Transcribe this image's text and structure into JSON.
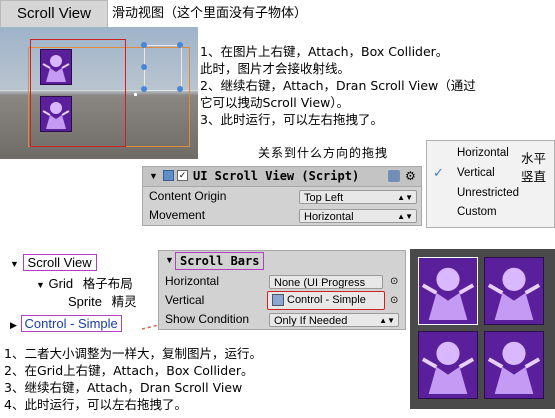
{
  "title_tab": "Scroll View",
  "title_note": "滑动视图（这个里面没有子物体）",
  "notes_top": [
    "1、在图片上右键，Attach，Box Collider。",
    "此时，图片才会接收射线。",
    "2、继续右键，Attach，Dran Scroll View（通过",
    "它可以拽动Scroll View）。",
    "3、此时运行，可以左右拖拽了。"
  ],
  "relation_note": "关系到什么方向的拖拽",
  "inspector": {
    "title": "UI Scroll View (Script)",
    "rows": [
      {
        "label": "Content Origin",
        "value": "Top Left"
      },
      {
        "label": "Movement",
        "value": "Horizontal"
      }
    ]
  },
  "movement_menu": {
    "items": [
      "Horizontal",
      "Vertical",
      "Unrestricted",
      "Custom"
    ],
    "selected": "Vertical",
    "check_mark": "✓"
  },
  "menu_notes": {
    "horizontal": "水平",
    "vertical": "竖直"
  },
  "hierarchy": {
    "items": [
      {
        "label": "Scroll View",
        "note": ""
      },
      {
        "label": "Grid",
        "note": "格子布局"
      },
      {
        "label": "Sprite",
        "note": "精灵"
      },
      {
        "label": "Control - Simple",
        "note": ""
      }
    ]
  },
  "scroll_bars": {
    "header": "Scroll Bars",
    "rows": [
      {
        "label": "Horizontal",
        "value": "None (UI Progress"
      },
      {
        "label": "Vertical",
        "value": "Control - Simple"
      },
      {
        "label": "Show Condition",
        "value": "Only If Needed"
      }
    ]
  },
  "notes_bottom": [
    "1、二者大小调整为一样大，复制图片，运行。",
    "2、在Grid上右键，Attach，Box Collider。",
    "3、继续右键，Attach，Dran Scroll View",
    "4、此时运行，可以左右拖拽了。"
  ],
  "icons": [
    "sprite-icon",
    "script-icon",
    "help-icon",
    "gear-icon",
    "object-picker-icon",
    "foldout-icon",
    "checkmark-icon",
    "dropdown-arrow-icon"
  ],
  "colors": {
    "highlight_purple": "#b040c0",
    "highlight_red": "#cc2222",
    "link_blue": "#1a3cb0",
    "sprite_purple": "#5a1f9a",
    "menu_select": "#3b78d8"
  }
}
